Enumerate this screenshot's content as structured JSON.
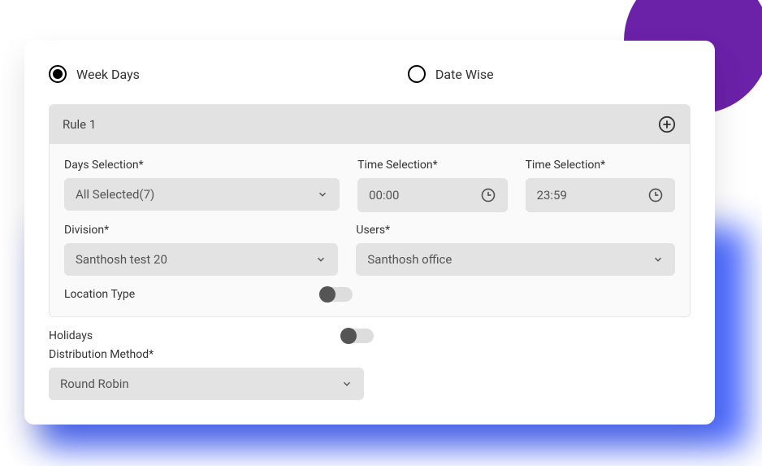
{
  "radios": {
    "weekdays": "Week Days",
    "datewise": "Date Wise"
  },
  "rule": {
    "title": "Rule 1",
    "days_label": "Days Selection*",
    "days_value": "All Selected(7)",
    "time1_label": "Time Selection*",
    "time1_value": "00:00",
    "time2_label": "Time Selection*",
    "time2_value": "23:59",
    "division_label": "Division*",
    "division_value": "Santhosh test 20",
    "users_label": "Users*",
    "users_value": "Santhosh office",
    "location_label": "Location Type"
  },
  "holidays_label": "Holidays",
  "dist_label": "Distribution Method*",
  "dist_value": "Round Robin"
}
